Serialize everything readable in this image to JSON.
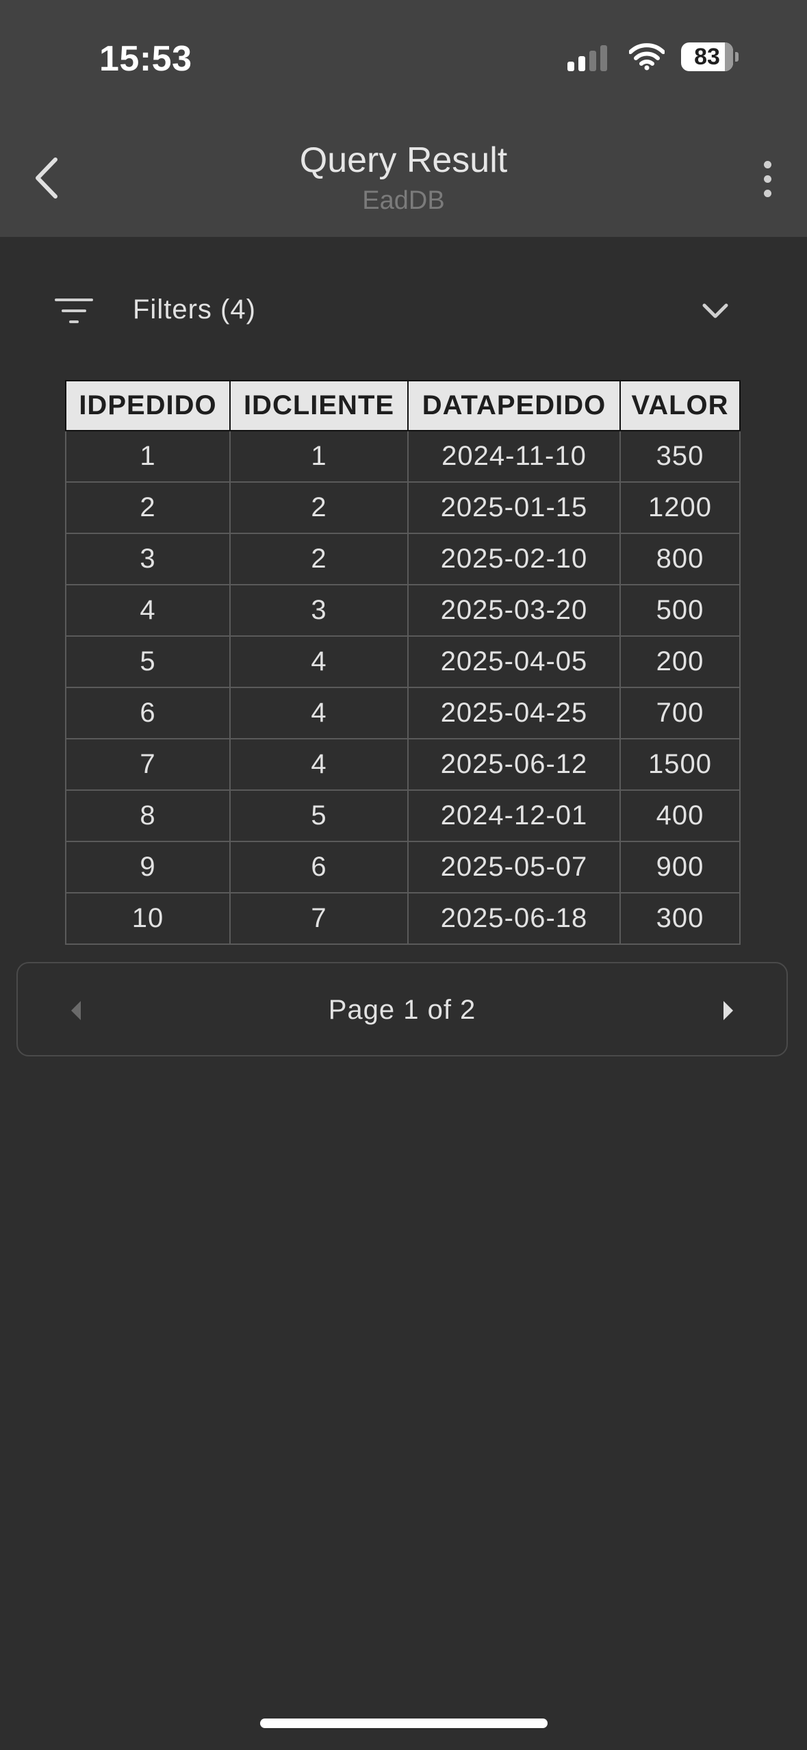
{
  "status_bar": {
    "time": "15:53",
    "battery": "83",
    "signal_bars_active": 2,
    "signal_bars_total": 4,
    "icons": [
      "signal-icon",
      "wifi-icon",
      "battery-icon"
    ]
  },
  "nav": {
    "back_icon": "chevron-left-icon",
    "title": "Query Result",
    "subtitle": "EadDB",
    "more_icon": "more-vertical-icon"
  },
  "filters": {
    "icon": "filter-icon",
    "label": "Filters (4)",
    "toggle_icon": "chevron-down-icon"
  },
  "table": {
    "columns": [
      "IDPEDIDO",
      "IDCLIENTE",
      "DATAPEDIDO",
      "VALOR"
    ],
    "rows": [
      [
        "1",
        "1",
        "2024-11-10",
        "350"
      ],
      [
        "2",
        "2",
        "2025-01-15",
        "1200"
      ],
      [
        "3",
        "2",
        "2025-02-10",
        "800"
      ],
      [
        "4",
        "3",
        "2025-03-20",
        "500"
      ],
      [
        "5",
        "4",
        "2025-04-05",
        "200"
      ],
      [
        "6",
        "4",
        "2025-04-25",
        "700"
      ],
      [
        "7",
        "4",
        "2025-06-12",
        "1500"
      ],
      [
        "8",
        "5",
        "2024-12-01",
        "400"
      ],
      [
        "9",
        "6",
        "2025-05-07",
        "900"
      ],
      [
        "10",
        "7",
        "2025-06-18",
        "300"
      ]
    ]
  },
  "pagination": {
    "label": "Page 1 of 2",
    "prev_icon": "triangle-left-icon",
    "next_icon": "triangle-right-icon"
  },
  "colors": {
    "header_bg": "#424242",
    "page_bg": "#2e2e2e",
    "table_header_bg": "#e6e6e6",
    "text": "#e2e2e2"
  }
}
